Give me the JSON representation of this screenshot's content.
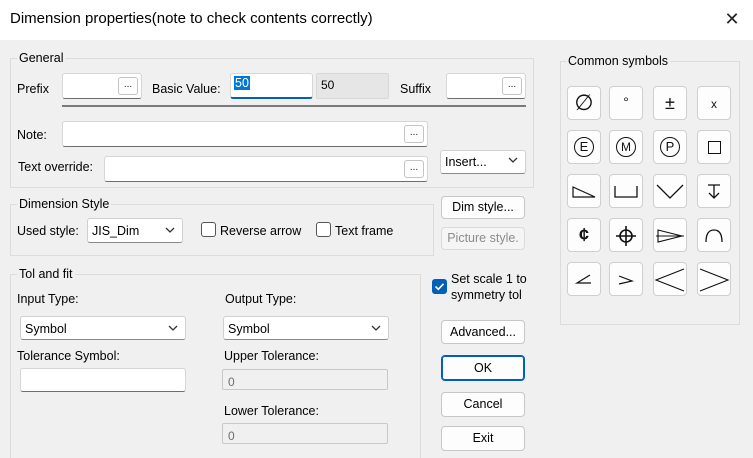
{
  "window": {
    "title": "Dimension properties(note to check contents correctly)"
  },
  "general": {
    "label": "General",
    "prefix_label": "Prefix",
    "prefix_value": "",
    "basic_value_label": "Basic Value:",
    "basic_value": "50",
    "basic_value_display": "50",
    "suffix_label": "Suffix",
    "suffix_value": "",
    "note_label": "Note:",
    "note_value": "",
    "text_override_label": "Text override:",
    "text_override_value": "",
    "browse_label": "...",
    "insert_label": "Insert..."
  },
  "dimension_style": {
    "label": "Dimension Style",
    "used_style_label": "Used style:",
    "used_style_value": "JIS_Dim",
    "reverse_arrow_label": "Reverse arrow",
    "reverse_arrow_checked": false,
    "text_frame_label": "Text frame",
    "text_frame_checked": false,
    "dim_style_button": "Dim style...",
    "picture_style_button": "Picture style."
  },
  "tol_fit": {
    "label": "Tol and fit",
    "input_type_label": "Input Type:",
    "input_type_value": "Symbol",
    "output_type_label": "Output Type:",
    "output_type_value": "Symbol",
    "tolerance_symbol_label": "Tolerance Symbol:",
    "tolerance_symbol_value": "",
    "upper_tolerance_label": "Upper Tolerance:",
    "upper_tolerance_value": "0",
    "lower_tolerance_label": "Lower Tolerance:",
    "lower_tolerance_value": "0",
    "set_scale_label_1": "Set scale 1 to",
    "set_scale_label_2": "symmetry tol",
    "set_scale_checked": true
  },
  "buttons": {
    "advanced": "Advanced...",
    "ok": "OK",
    "cancel": "Cancel",
    "exit": "Exit"
  },
  "common_symbols": {
    "label": "Common symbols",
    "text_symbols": {
      "diameter": "∅",
      "degree": "°",
      "plus_minus": "±",
      "times": "x",
      "centerline": "¢"
    },
    "icons": [
      "diameter-icon",
      "degree-icon",
      "plus-minus-icon",
      "times-icon",
      "e-circle-icon",
      "m-circle-icon",
      "p-circle-icon",
      "square-icon",
      "slope-icon",
      "counterbore-icon",
      "countersink-icon",
      "depth-icon",
      "centerline-icon",
      "target-point-icon",
      "taper-icon",
      "arc-length-icon",
      "angle-small-icon",
      "angle-small-right-icon",
      "angle-large-left-icon",
      "angle-large-right-icon"
    ],
    "circle_letters": {
      "e": "E",
      "m": "M",
      "p": "P"
    }
  }
}
